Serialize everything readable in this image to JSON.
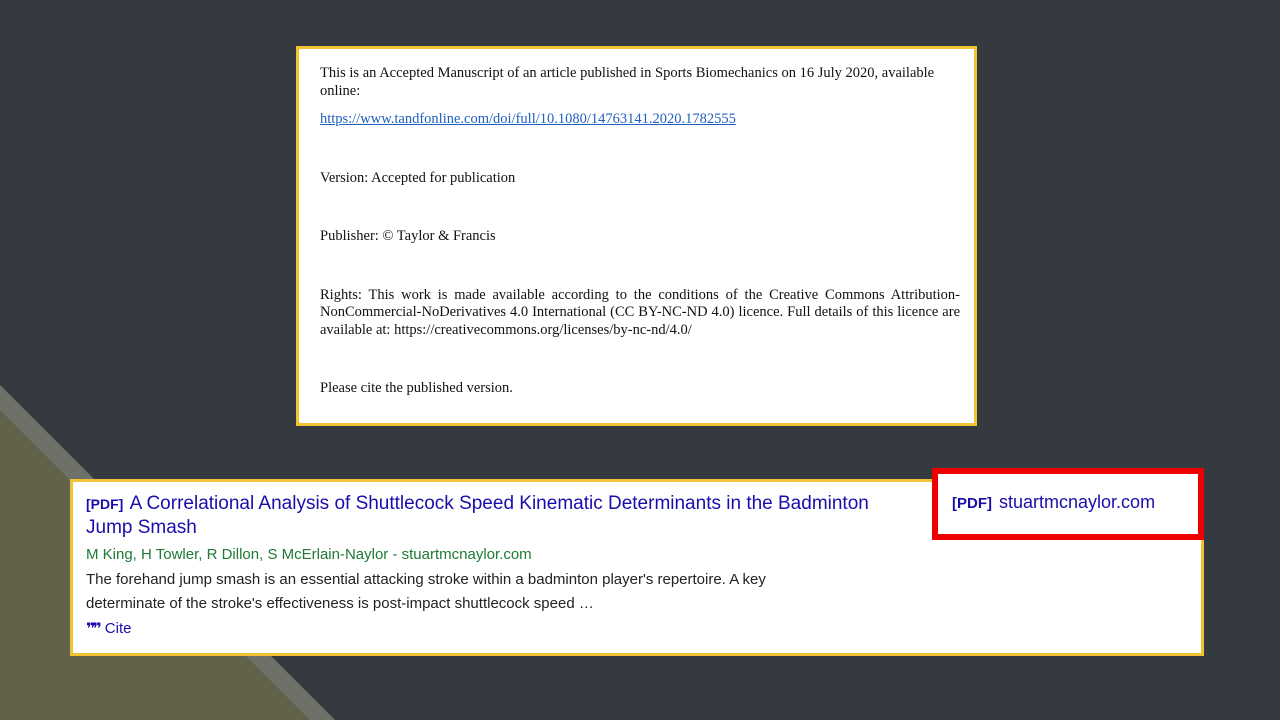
{
  "manuscript": {
    "line1": "This is an Accepted Manuscript of an article published in Sports Biomechanics on 16 July 2020, available online:",
    "link": "https://www.tandfonline.com/doi/full/10.1080/14763141.2020.1782555",
    "version": "Version: Accepted for publication",
    "publisher": "Publisher: © Taylor & Francis",
    "rights": "Rights: This work is made available according to the conditions of the Creative Commons Attribution-NonCommercial-NoDerivatives 4.0 International (CC BY-NC-ND 4.0) licence. Full details of this licence are available at: https://creativecommons.org/licenses/by-nc-nd/4.0/",
    "cite_note": "Please cite the published version."
  },
  "result": {
    "pdf_tag": "[PDF]",
    "title": "A Correlational Analysis of Shuttlecock Speed Kinematic Determinants in the Badminton Jump Smash",
    "authors": "M King, H Towler, R Dillon, S McErlain-Naylor - stuartmcnaylor.com",
    "snippet": "The forehand jump smash is an essential attacking stroke within a badminton player's repertoire. A key determinate of the stroke's effectiveness is post-impact shuttlecock speed …",
    "cite_label": "Cite",
    "cite_icon": "quote-icon"
  },
  "pdf_link": {
    "tag": "[PDF]",
    "domain": "stuartmcnaylor.com"
  },
  "colors": {
    "background": "#343a40",
    "panel_border": "#f1c232",
    "highlight_border": "#ee0000",
    "link_blue": "#1a0dab",
    "author_green": "#1f7a35"
  }
}
